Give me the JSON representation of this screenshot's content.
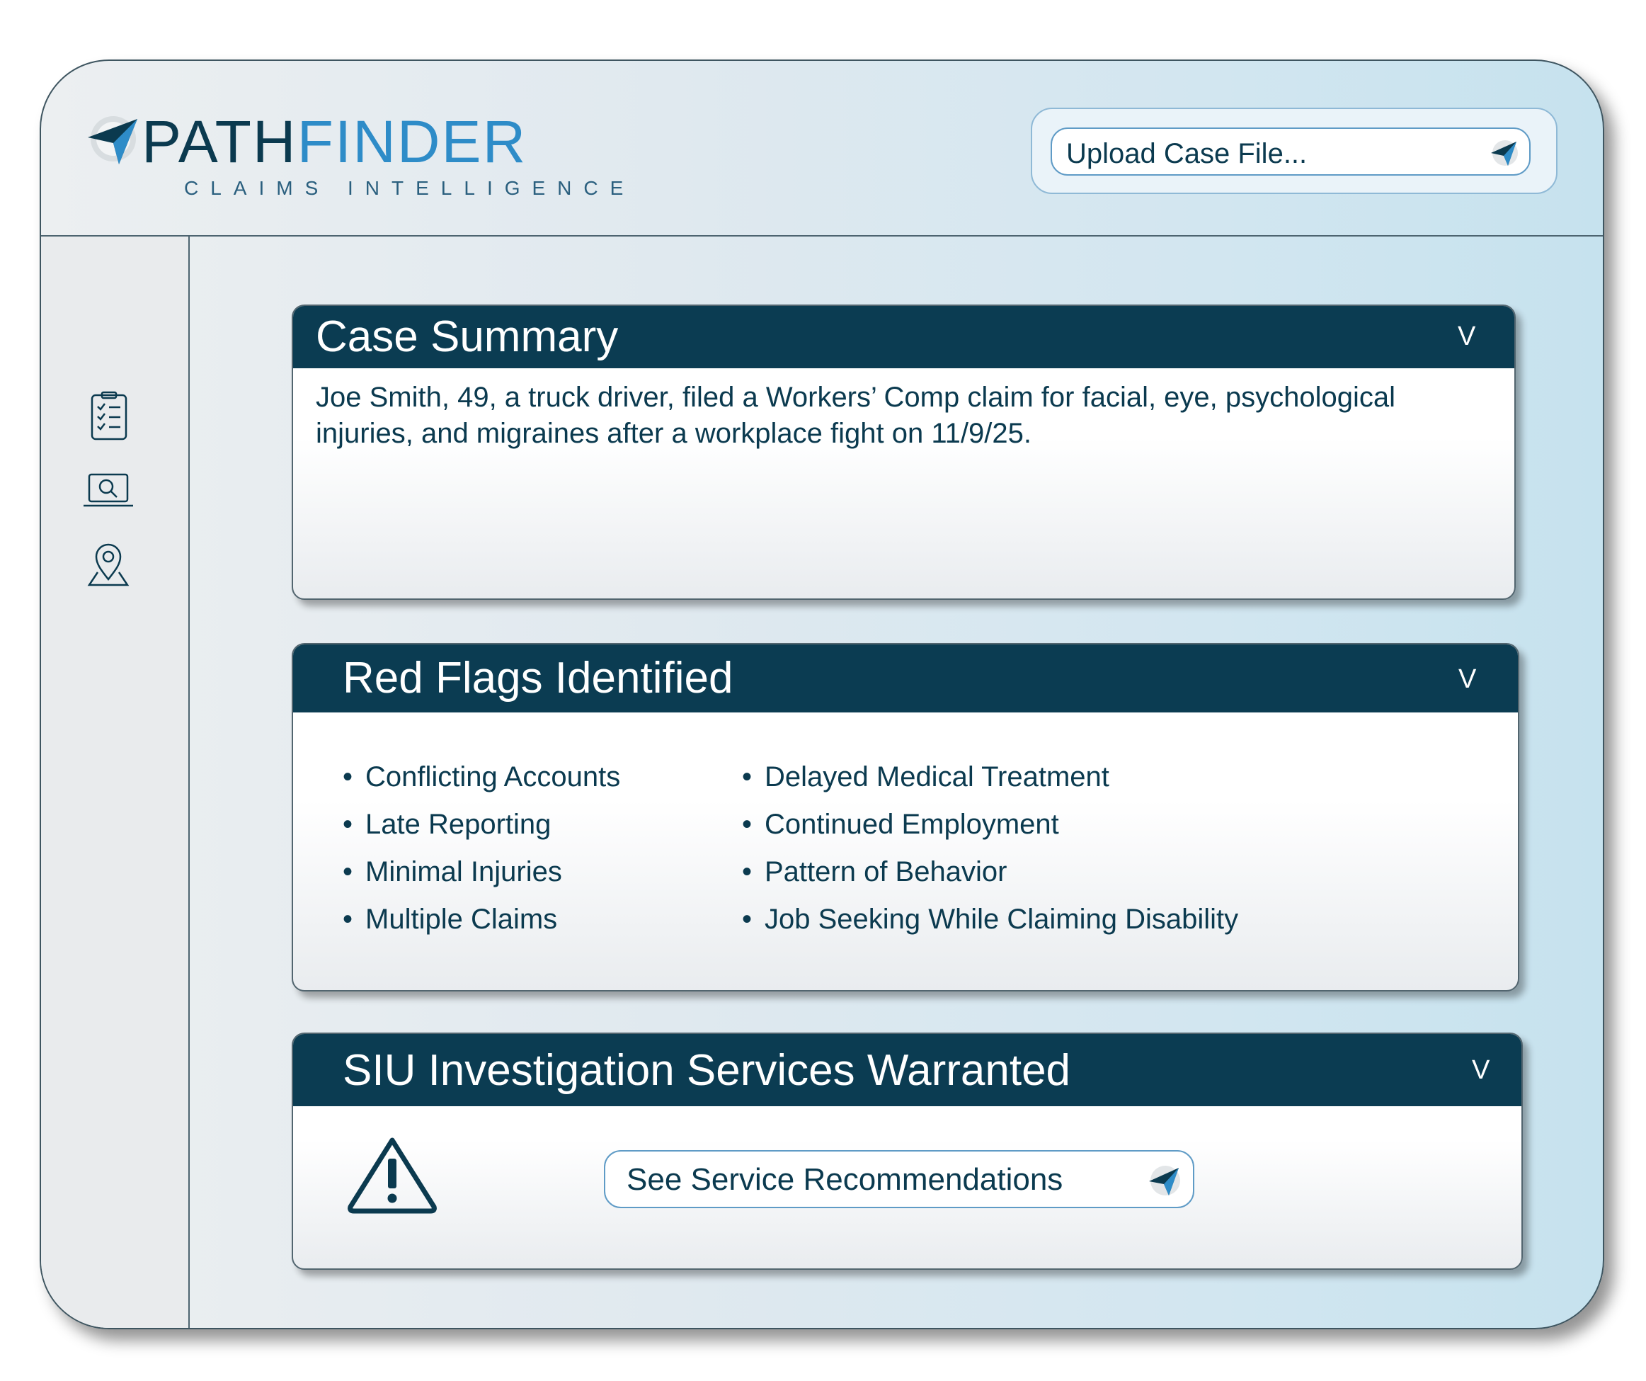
{
  "brand": {
    "name_part1": "PATH",
    "name_part2": "FINDER",
    "tagline": "CLAIMS INTELLIGENCE"
  },
  "header": {
    "upload_label": "Upload Case File..."
  },
  "sidebar": {
    "items": [
      {
        "icon": "checklist-icon"
      },
      {
        "icon": "laptop-search-icon"
      },
      {
        "icon": "location-pin-icon"
      }
    ]
  },
  "case_summary": {
    "title": "Case Summary",
    "chevron": "V",
    "text": "Joe Smith, 49, a truck driver, filed a Workers’ Comp claim for facial, eye, psychological injuries, and migraines after a workplace fight on 11/9/25."
  },
  "red_flags": {
    "title": "Red Flags Identified",
    "chevron": "V",
    "bullet": "•",
    "left": [
      "Conflicting Accounts",
      "Late Reporting",
      "Minimal Injuries",
      "Multiple Claims"
    ],
    "right": [
      "Delayed Medical Treatment",
      "Continued Employment",
      "Pattern of Behavior",
      "Job Seeking While Claiming Disability"
    ]
  },
  "siu": {
    "title": "SIU Investigation Services Warranted",
    "chevron": "V",
    "button_label": "See Service Recommendations",
    "warning_icon": "warning-triangle-icon"
  },
  "colors": {
    "navy": "#0b3c52",
    "accent_blue": "#2e8cc8",
    "text": "#0b3a4f"
  }
}
